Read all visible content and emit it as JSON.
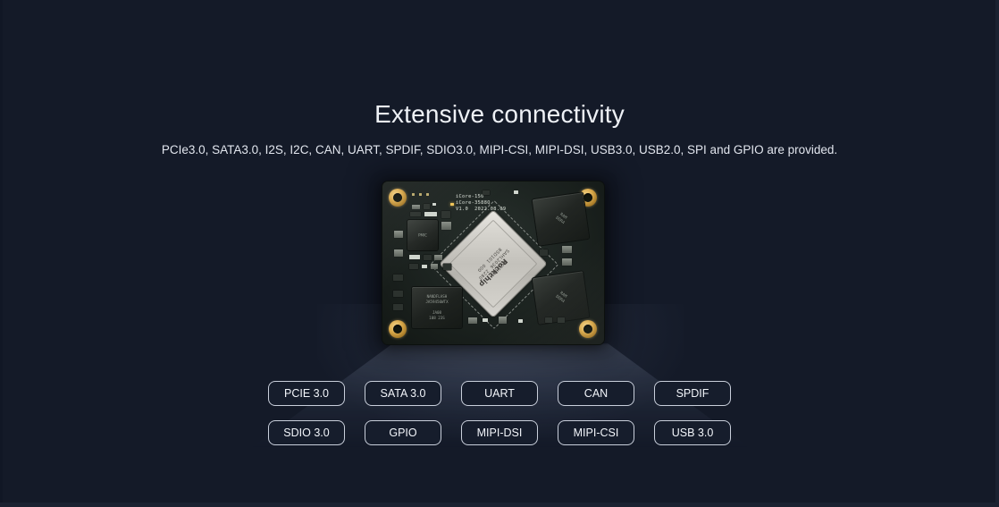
{
  "page": {
    "title": "Extensive connectivity",
    "subtitle": "PCIe3.0, SATA3.0, I2S, I2C, CAN, UART, SPDIF, SDIO3.0, MIPI-CSI, MIPI-DSI, USB3.0, USB2.0, SPI and GPIO are provided.",
    "background_color": "#141a28",
    "title_color": "#eef1f6",
    "tag_border_color": "#c9cfdb",
    "tag_fill_color": "#161d2c"
  },
  "board": {
    "alt": "Rockchip RK3588 system-on-module board, top view",
    "silkscreen": "iCore-150\niCore-3588Q\nV1.0  2022.08.09",
    "soc_brand": "Rockchip",
    "soc_text": "RK3588M\nSAHL2036  2280\nBSD101  000",
    "ram_label_1": "RAM\nDDR4",
    "ram_label_2": "RAM\nDDR4",
    "flash_label": "NANDFLASH\nJA59450WTX\n\nJA08\n108 23S",
    "qfp_label": "PMIC"
  },
  "tags": {
    "row1": [
      "PCIE 3.0",
      "SATA 3.0",
      "UART",
      "CAN",
      "SPDIF"
    ],
    "row2": [
      "SDIO 3.0",
      "GPIO",
      "MIPI-DSI",
      "MIPI-CSI",
      "USB 3.0"
    ]
  }
}
